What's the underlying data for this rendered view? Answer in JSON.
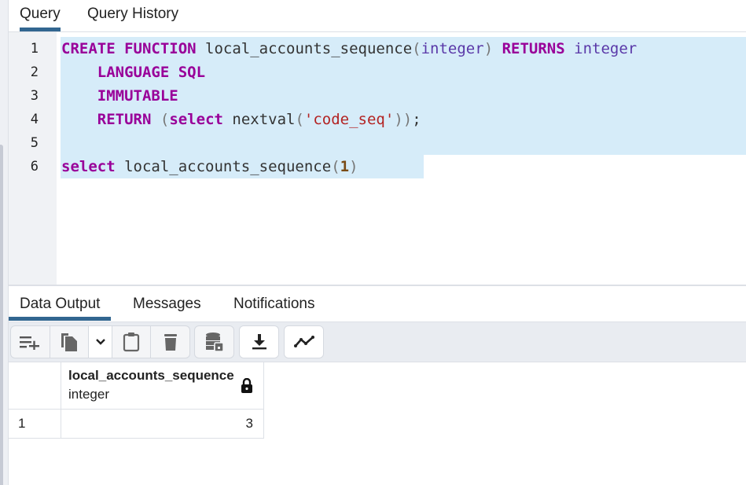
{
  "query_tabs": [
    {
      "label": "Query",
      "active": true
    },
    {
      "label": "Query History",
      "active": false
    }
  ],
  "editor": {
    "line_numbers": [
      "1",
      "2",
      "3",
      "4",
      "5",
      "6"
    ],
    "lines": [
      [
        {
          "t": "CREATE",
          "c": "kw"
        },
        {
          "t": " ",
          "c": "plain"
        },
        {
          "t": "FUNCTION",
          "c": "kw"
        },
        {
          "t": " local_accounts_sequence",
          "c": "plain"
        },
        {
          "t": "(",
          "c": "paren"
        },
        {
          "t": "integer",
          "c": "ty"
        },
        {
          "t": ")",
          "c": "paren"
        },
        {
          "t": " ",
          "c": "plain"
        },
        {
          "t": "RETURNS",
          "c": "kw"
        },
        {
          "t": " ",
          "c": "plain"
        },
        {
          "t": "integer",
          "c": "ty"
        }
      ],
      [
        {
          "t": "    ",
          "c": "plain"
        },
        {
          "t": "LANGUAGE",
          "c": "kw"
        },
        {
          "t": " ",
          "c": "plain"
        },
        {
          "t": "SQL",
          "c": "kw"
        }
      ],
      [
        {
          "t": "    ",
          "c": "plain"
        },
        {
          "t": "IMMUTABLE",
          "c": "kw"
        }
      ],
      [
        {
          "t": "    ",
          "c": "plain"
        },
        {
          "t": "RETURN",
          "c": "kw"
        },
        {
          "t": " ",
          "c": "plain"
        },
        {
          "t": "(",
          "c": "paren"
        },
        {
          "t": "select",
          "c": "kw"
        },
        {
          "t": " nextval",
          "c": "plain"
        },
        {
          "t": "(",
          "c": "paren"
        },
        {
          "t": "'code_seq'",
          "c": "str"
        },
        {
          "t": "))",
          "c": "paren"
        },
        {
          "t": ";",
          "c": "plain"
        }
      ],
      [],
      [
        {
          "t": "select",
          "c": "kw"
        },
        {
          "t": " local_accounts_sequence",
          "c": "plain"
        },
        {
          "t": "(",
          "c": "paren"
        },
        {
          "t": "1",
          "c": "num"
        },
        {
          "t": ")",
          "c": "paren"
        }
      ]
    ]
  },
  "output_tabs": [
    {
      "label": "Data Output",
      "active": true
    },
    {
      "label": "Messages",
      "active": false
    },
    {
      "label": "Notifications",
      "active": false
    }
  ],
  "toolbar": {
    "buttons": [
      {
        "name": "add-row",
        "icon": "add-row-icon"
      },
      {
        "name": "copy",
        "icon": "copy-icon"
      },
      {
        "name": "copy-options",
        "icon": "chevron-down-icon"
      },
      {
        "name": "paste",
        "icon": "clipboard-icon"
      },
      {
        "name": "delete",
        "icon": "trash-icon"
      },
      {
        "name": "save-data",
        "icon": "database-save-icon"
      },
      {
        "name": "download",
        "icon": "download-icon"
      },
      {
        "name": "graph-visualiser",
        "icon": "line-chart-icon"
      }
    ]
  },
  "grid": {
    "columns": [
      {
        "name": "local_accounts_sequence",
        "type": "integer",
        "readonly_icon": "lock-icon"
      }
    ],
    "rows": [
      {
        "row_number": "1",
        "values": [
          "3"
        ]
      }
    ]
  }
}
